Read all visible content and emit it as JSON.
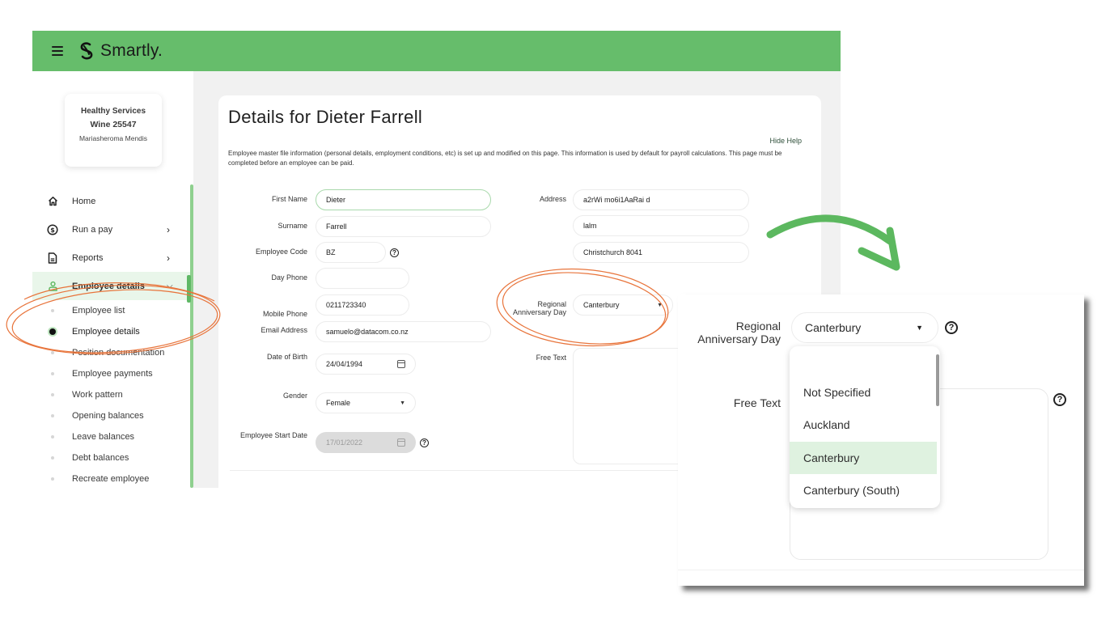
{
  "app": {
    "brand_name": "Smartly.",
    "menu_icon": "hamburger-icon",
    "logo_icon": "smartly-logo-icon",
    "brand_color": "#66bd6b"
  },
  "sidebar": {
    "company": {
      "name": "Healthy Services",
      "code": "Wine 25547",
      "user": "Mariasheroma Mendis"
    },
    "items": [
      {
        "label": "Home",
        "icon": "home-icon"
      },
      {
        "label": "Run a pay",
        "icon": "dollar-icon",
        "chevron": "chevron-right-icon"
      },
      {
        "label": "Reports",
        "icon": "document-icon",
        "chevron": "chevron-right-icon"
      },
      {
        "label": "Employee details",
        "icon": "person-icon",
        "chevron": "chevron-down-icon",
        "active": true
      }
    ],
    "sub_items": [
      {
        "label": "Employee list"
      },
      {
        "label": "Employee details",
        "current": true
      },
      {
        "label": "Position documentation"
      },
      {
        "label": "Employee payments"
      },
      {
        "label": "Work pattern"
      },
      {
        "label": "Opening balances"
      },
      {
        "label": "Leave balances"
      },
      {
        "label": "Debt balances"
      },
      {
        "label": "Recreate employee"
      }
    ]
  },
  "main": {
    "title": "Details for Dieter Farrell",
    "hide_help": "Hide Help",
    "help_text": "Employee master file information (personal details, employment conditions, etc) is set up and modified on this page. This information is used by default for payroll calculations. This page must be completed before an employee can be paid.",
    "fields": {
      "first_name": {
        "label": "First Name",
        "value": "Dieter"
      },
      "surname": {
        "label": "Surname",
        "value": "Farrell"
      },
      "employee_code": {
        "label": "Employee Code",
        "value": "BZ"
      },
      "day_phone": {
        "label": "Day Phone",
        "value": ""
      },
      "mobile_phone": {
        "label": "Mobile Phone",
        "value": "0211723340"
      },
      "email": {
        "label": "Email Address",
        "value": "samuelo@datacom.co.nz"
      },
      "dob": {
        "label": "Date of Birth",
        "value": "24/04/1994"
      },
      "gender": {
        "label": "Gender",
        "value": "Female"
      },
      "start_date": {
        "label": "Employee Start Date",
        "value": "17/01/2022"
      },
      "address": {
        "label": "Address",
        "line1": "a2rWi mo6i1AaRai d",
        "line2": "lalm",
        "line3": "Christchurch 8041"
      },
      "regional_anniversary": {
        "label_line1": "Regional",
        "label_line2": "Anniversary Day",
        "value": "Canterbury"
      },
      "free_text": {
        "label": "Free Text",
        "value": ""
      }
    },
    "help_icon_glyph": "?"
  },
  "callout": {
    "label_line1": "Regional",
    "label_line2": "Anniversary Day",
    "selected": "Canterbury",
    "free_text_label": "Free Text",
    "options": [
      {
        "label": "",
        "selected": false
      },
      {
        "label": "Not Specified",
        "selected": false
      },
      {
        "label": "Auckland",
        "selected": false
      },
      {
        "label": "Canterbury",
        "selected": true
      },
      {
        "label": "Canterbury (South)",
        "selected": false
      }
    ]
  },
  "annotations": {
    "circle_color": "#e8743b",
    "arrow_color": "#5cb85f"
  }
}
